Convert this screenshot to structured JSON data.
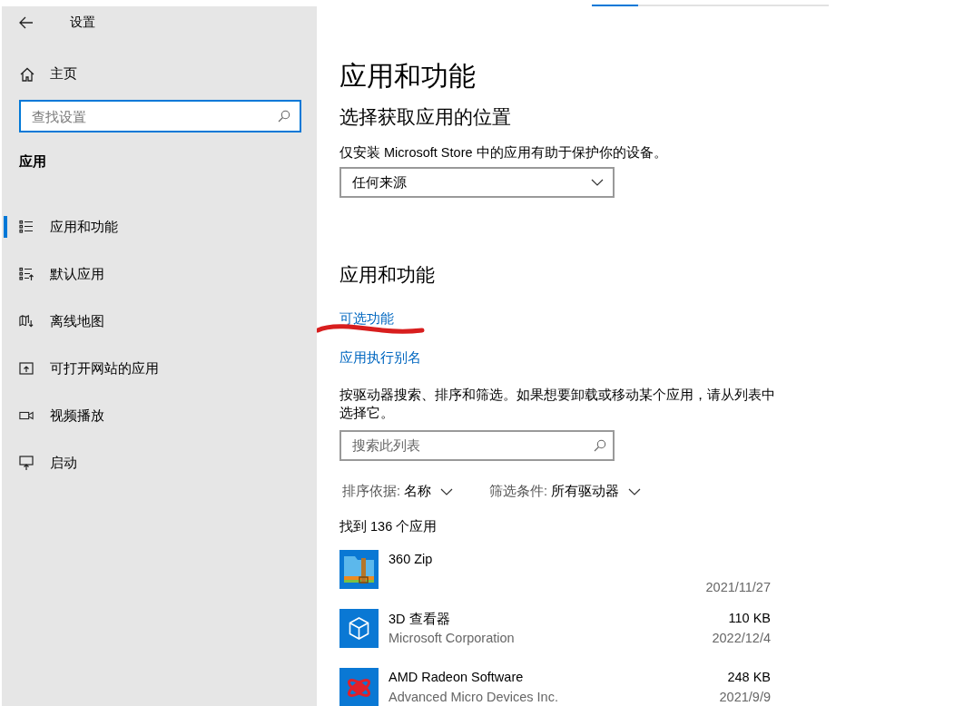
{
  "header": {
    "title": "设置"
  },
  "sidebar": {
    "home": "主页",
    "search": {
      "placeholder": "查找设置",
      "focused": true
    },
    "section": "应用",
    "items": [
      {
        "label": "应用和功能",
        "kind": "list",
        "selected": true
      },
      {
        "label": "默认应用",
        "kind": "defaults",
        "selected": false
      },
      {
        "label": "离线地图",
        "kind": "map",
        "selected": false
      },
      {
        "label": "可打开网站的应用",
        "kind": "websites",
        "selected": false
      },
      {
        "label": "视频播放",
        "kind": "video",
        "selected": false
      },
      {
        "label": "启动",
        "kind": "startup",
        "selected": false
      }
    ]
  },
  "main": {
    "title": "应用和功能",
    "subtitle": "选择获取应用的位置",
    "description": "仅安装 Microsoft Store 中的应用有助于保护你的设备。",
    "source_dropdown": "任何来源",
    "section_title": "应用和功能",
    "links": [
      "可选功能",
      "应用执行别名"
    ],
    "help_text": "按驱动器搜索、排序和筛选。如果想要卸载或移动某个应用，请从列表中选择它。",
    "list_search": {
      "placeholder": "搜索此列表"
    },
    "sort": {
      "label": "排序依据:",
      "value": "名称"
    },
    "filter": {
      "label": "筛选条件:",
      "value": "所有驱动器"
    },
    "count": "找到 136 个应用",
    "apps": [
      {
        "kind": "zip",
        "name": "360 Zip",
        "date": "2021/11/27"
      },
      {
        "kind": "cube",
        "name": "3D 查看器",
        "publisher": "Microsoft Corporation",
        "size": "110 KB",
        "date": "2022/12/4"
      },
      {
        "kind": "amd",
        "name": "AMD Radeon Software",
        "publisher": "Advanced Micro Devices Inc.",
        "size": "248 KB",
        "date": "2021/9/9"
      }
    ]
  }
}
